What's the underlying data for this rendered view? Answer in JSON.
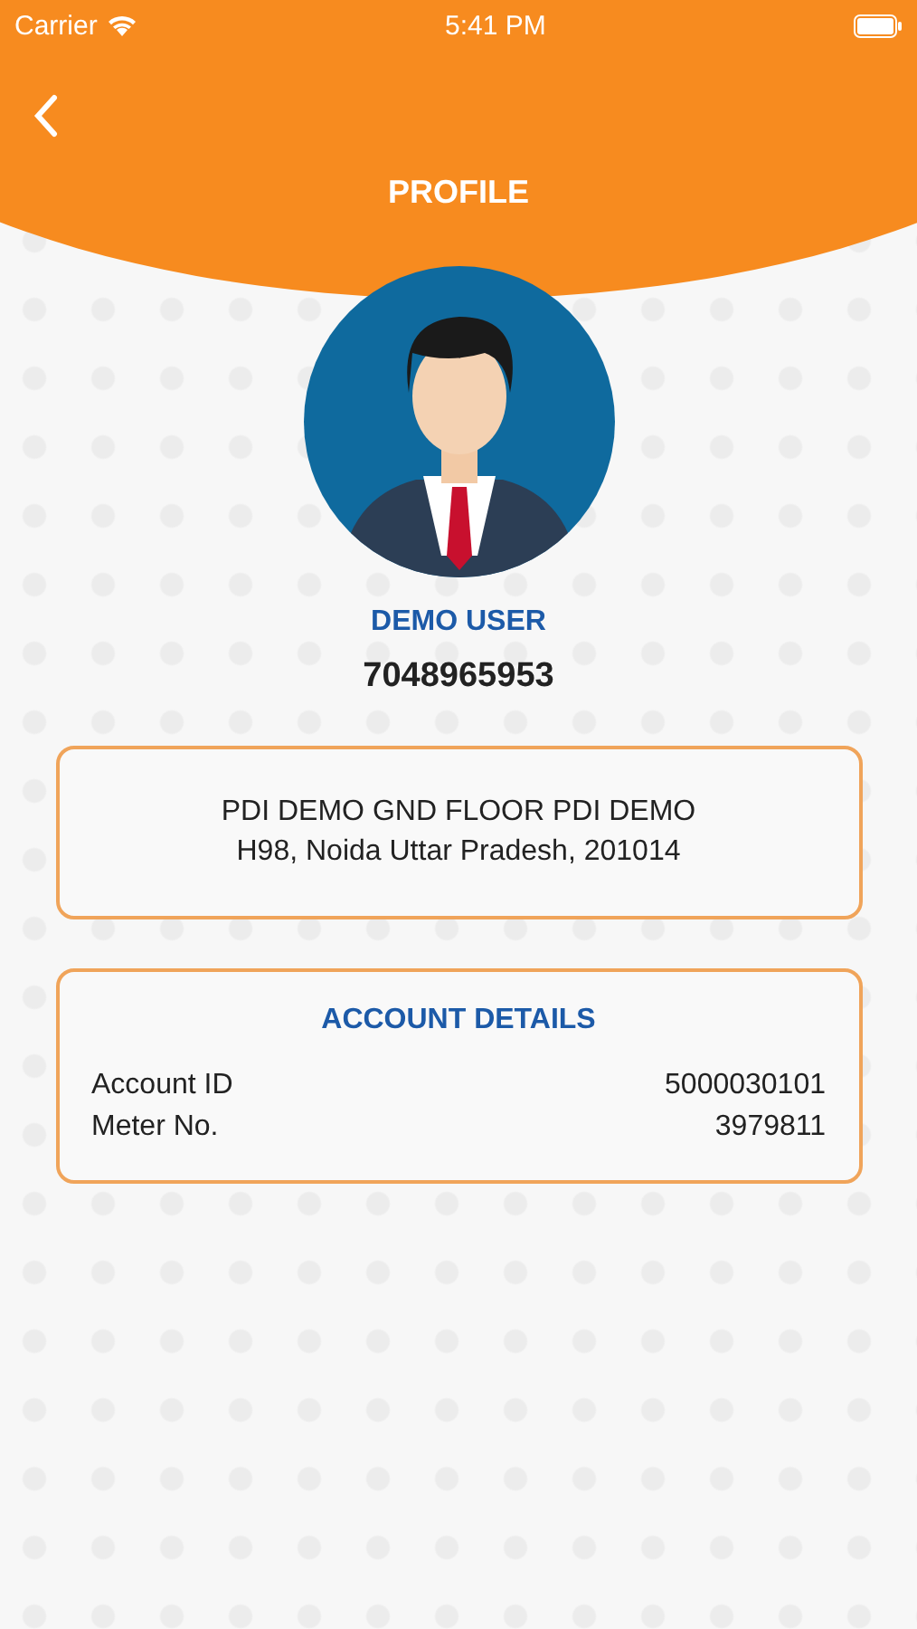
{
  "status_bar": {
    "carrier": "Carrier",
    "time": "5:41 PM"
  },
  "header": {
    "title": "PROFILE"
  },
  "user": {
    "name": "DEMO USER",
    "phone": "7048965953"
  },
  "address": {
    "lines": [
      "PDI DEMO GND FLOOR PDI DEMO",
      "H98, Noida Uttar Pradesh, 201014"
    ]
  },
  "account": {
    "title": "ACCOUNT DETAILS",
    "rows": [
      {
        "label": "Account ID",
        "value": "5000030101"
      },
      {
        "label": "Meter No.",
        "value": "3979811"
      }
    ]
  }
}
